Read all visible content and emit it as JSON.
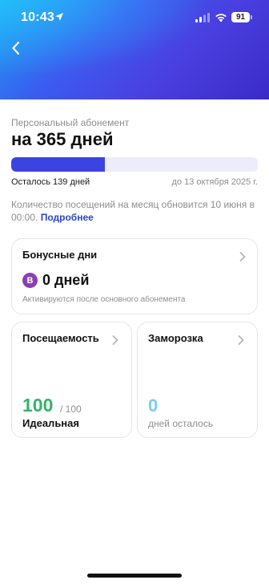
{
  "status_bar": {
    "time": "10:43",
    "battery": "91",
    "icons": [
      "location-arrow-icon",
      "cellular-signal-icon",
      "wifi-icon",
      "battery-icon"
    ]
  },
  "header": {
    "back_icon": "chevron-left-icon",
    "gradient_colors": [
      "#1aa3f0",
      "#3b5cf0",
      "#3a2bc8"
    ]
  },
  "subscription": {
    "subtitle": "Персональный абонемент",
    "title": "на 365 дней",
    "progress_fraction": 0.38,
    "progress_color": "#3b44e0",
    "remaining": "Осталось 139 дней",
    "until": "до 13 октября 2025 г.",
    "note": "Количество посещений на месяц обновится 10 июня в 00:00.",
    "note_link": "Подробнее"
  },
  "bonus_card": {
    "title": "Бонусные дни",
    "badge": "B",
    "value": "0 дней",
    "caption": "Активируются после основного абонемента",
    "chevron_icon": "chevron-right-icon"
  },
  "attendance_card": {
    "title": "Посещаемость",
    "value": "100",
    "max": "/ 100",
    "label": "Идеальная",
    "value_color": "#33b36a",
    "chevron_icon": "chevron-right-icon"
  },
  "freeze_card": {
    "title": "Заморозка",
    "value": "0",
    "label": "дней осталось",
    "value_color": "#7ecde8",
    "chevron_icon": "chevron-right-icon"
  }
}
